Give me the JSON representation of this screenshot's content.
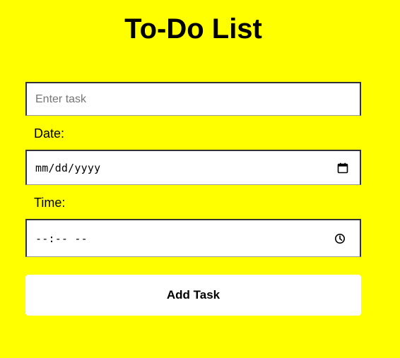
{
  "page": {
    "title": "To-Do List",
    "background_color": "#ffff00"
  },
  "form": {
    "task_input": {
      "value": "",
      "placeholder": "Enter task"
    },
    "date": {
      "label": "Date:",
      "display_value": "mm/dd/yyyy",
      "icon": "calendar-icon"
    },
    "time": {
      "label": "Time:",
      "display_value": "--:-- --",
      "icon": "clock-icon"
    },
    "add_button_label": "Add Task"
  }
}
